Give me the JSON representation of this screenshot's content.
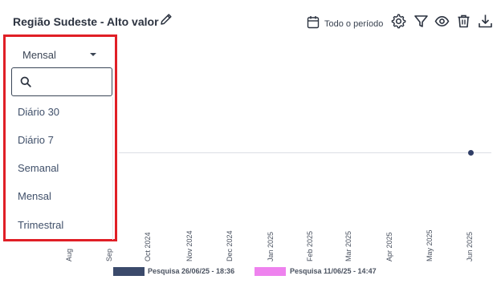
{
  "header": {
    "title": "Região Sudeste - Alto valor",
    "period_label": "Todo o período"
  },
  "toolbar": {
    "icons": [
      "pencil-icon",
      "calendar-icon",
      "gear-icon",
      "filter-icon",
      "eye-icon",
      "trash-icon",
      "download-icon"
    ]
  },
  "dropdown": {
    "selected": "Mensal",
    "search_placeholder": "",
    "options": [
      "Diário 30",
      "Diário 7",
      "Semanal",
      "Mensal",
      "Trimestral"
    ]
  },
  "chart": {
    "x_ticks": [
      "Aug",
      "Sep",
      "Oct 2024",
      "Nov 2024",
      "Dec 2024",
      "Jan 2025",
      "Feb 2025",
      "Mar 2025",
      "Apr 2025",
      "May 2025",
      "Jun 2025"
    ],
    "legend": [
      {
        "label": "Pesquisa 26/06/25 - 18:36",
        "color": "#3b4a6b"
      },
      {
        "label": "Pesquisa 11/06/25 - 14:47",
        "color": "#ee82ee"
      }
    ]
  }
}
